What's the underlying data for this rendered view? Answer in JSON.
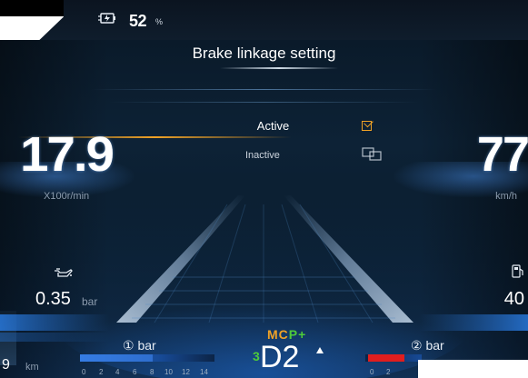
{
  "status_bar": {
    "battery_icon": "battery-charge-icon",
    "battery_value": "52",
    "battery_unit": "%"
  },
  "menu": {
    "title": "Brake linkage setting",
    "options": [
      {
        "label": "Active",
        "selected": true,
        "icon": "checkbox-checked-icon"
      },
      {
        "label": "Inactive",
        "selected": false,
        "icon": "inactive-icon"
      }
    ],
    "accent_color": "#f0a226"
  },
  "rpm": {
    "value": "17.9",
    "unit": "X100r/min"
  },
  "speed": {
    "value": "77",
    "unit": "km/h"
  },
  "oil": {
    "icon": "oil-can-icon",
    "value": "0.35",
    "unit": "bar"
  },
  "fuel": {
    "icon": "fuel-pump-icon",
    "value": "40"
  },
  "odometer": {
    "value": "9",
    "unit": "km"
  },
  "brake_circuit_1": {
    "label": "① bar",
    "ticks": [
      "0",
      "2",
      "4",
      "6",
      "8",
      "10",
      "12",
      "14"
    ]
  },
  "brake_circuit_2": {
    "label": "② bar",
    "ticks": [
      "0",
      "2"
    ]
  },
  "transmission": {
    "mode_m": "M",
    "mode_c": "C",
    "mode_p": "P+",
    "gear_prefix": "3",
    "gear": "D2",
    "gear_arrow": "up-arrow-icon"
  }
}
